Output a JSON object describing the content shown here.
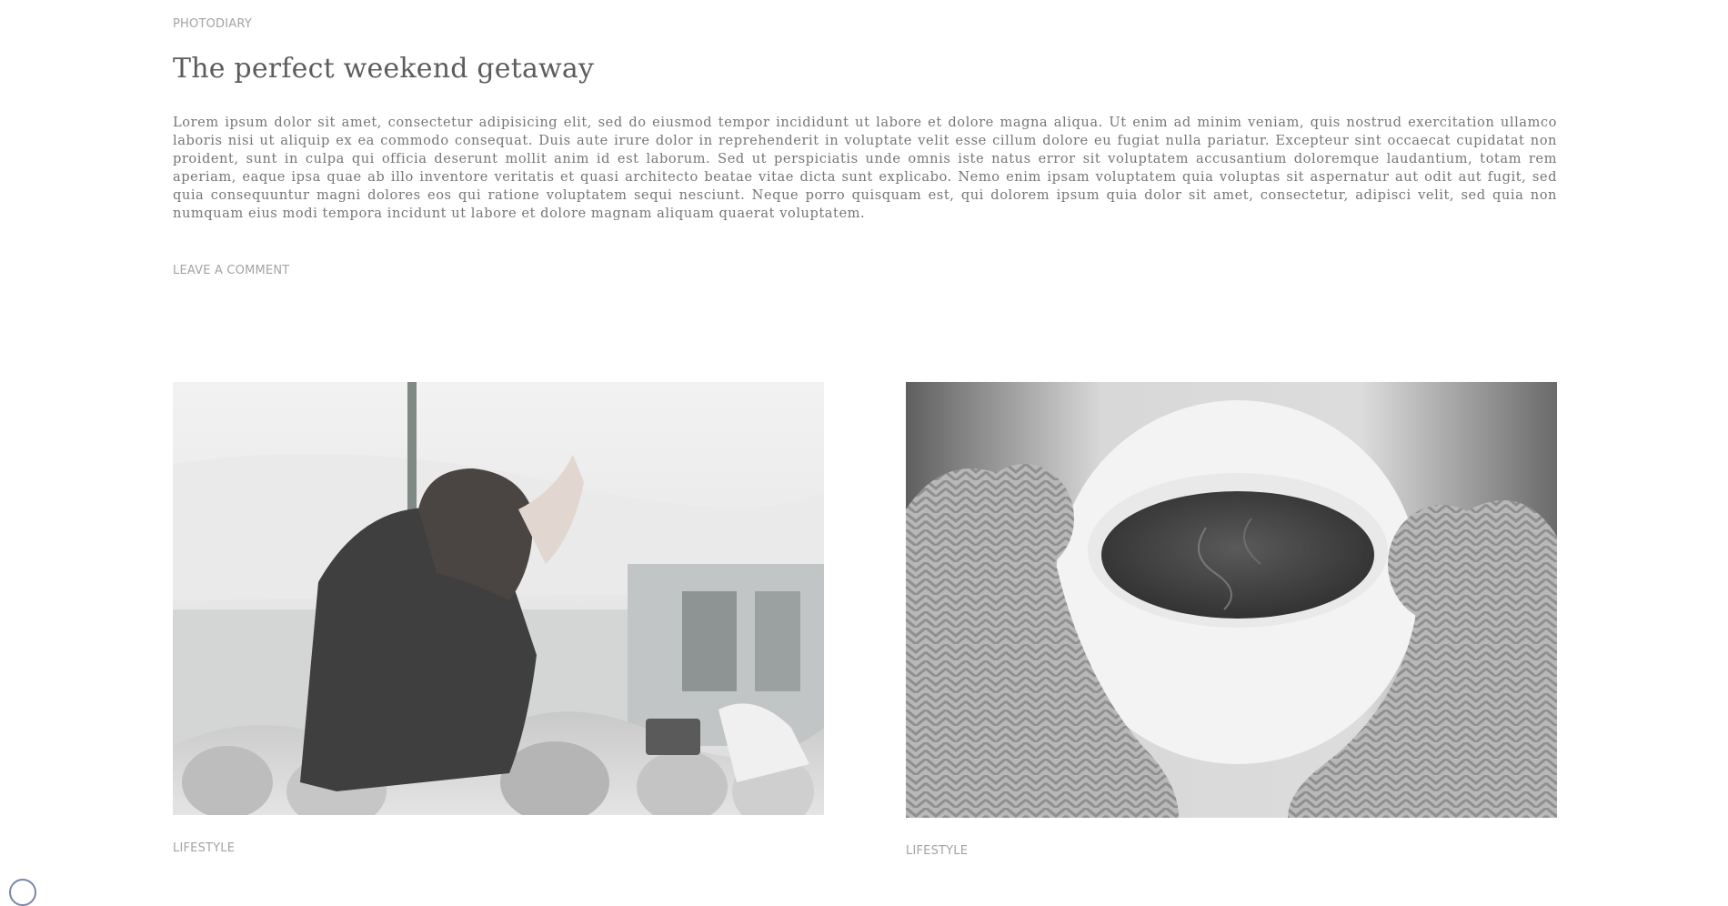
{
  "post": {
    "category": "PHOTODIARY",
    "title": "The perfect weekend getaway",
    "excerpt": "Lorem ipsum dolor sit amet, consectetur adipisicing elit, sed do eiusmod tempor incididunt ut labore et dolore magna aliqua. Ut enim ad minim veniam, quis nostrud exercitation ullamco laboris nisi ut aliquip ex ea commodo consequat. Duis aute irure dolor in reprehenderit in voluptate velit esse cillum dolore eu fugiat nulla pariatur. Excepteur sint occaecat cupidatat non proident, sunt in culpa qui officia deserunt mollit anim id est laborum. Sed ut perspiciatis unde omnis iste natus error sit voluptatem accusantium doloremque laudantium, totam rem aperiam, eaque ipsa quae ab illo inventore veritatis et quasi architecto beatae vitae dicta sunt explicabo. Nemo enim ipsam voluptatem quia voluptas sit aspernatur aut odit aut fugit, sed quia consequuntur magni dolores eos qui ratione voluptatem sequi nesciunt. Neque porro quisquam est, qui dolorem ipsum quia dolor sit amet, consectetur, adipisci velit, sed quia non numquam eius modi tempora incidunt ut labore et dolore magnam aliquam quaerat voluptatem.",
    "comment_link": "LEAVE A COMMENT"
  },
  "cards": [
    {
      "image": "concert-crowd-photo",
      "category": "LIFESTYLE"
    },
    {
      "image": "coffee-cup-mittens-photo",
      "category": "LIFESTYLE"
    }
  ],
  "colors": {
    "text_muted": "#a3a3a3",
    "title": "#5c5c5c",
    "body": "#767676"
  }
}
